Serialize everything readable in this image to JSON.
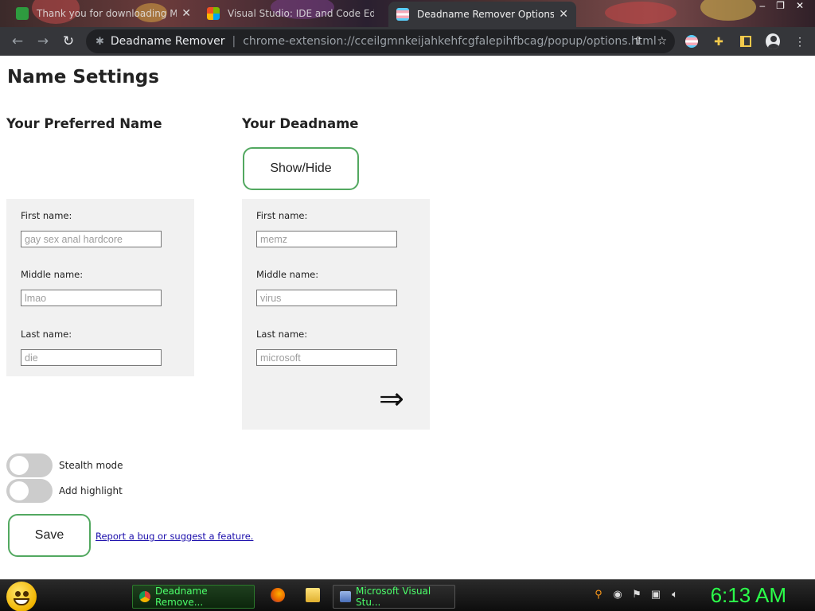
{
  "browser": {
    "tabs": [
      {
        "title": "Thank you for downloading Mi...",
        "favicon_color": "#2e9b3f",
        "active": false
      },
      {
        "title": "Visual Studio: IDE and Code Edit...",
        "favicon_color": "#f25022",
        "active": false
      },
      {
        "title": "Deadname Remover Options",
        "favicon_color": "#f5a9b8",
        "active": true
      }
    ],
    "close_glyph": "✕",
    "window_controls": [
      "–",
      "❐",
      "✕"
    ],
    "nav": {
      "back_glyph": "←",
      "forward_glyph": "→",
      "reload_glyph": "↻"
    },
    "omnibox": {
      "icon": "puzzle-icon",
      "site_name": "Deadname Remover",
      "url": "chrome-extension://cceilgmnkeijahkehfcgfalepihfbcag/popup/options.html"
    },
    "toolbar_icons": [
      "share-icon",
      "star-icon",
      "trans-flag-icon",
      "puzzle-icon",
      "side-panel-icon",
      "profile-icon",
      "menu-icon"
    ]
  },
  "page": {
    "title": "Name Settings",
    "preferred": {
      "heading": "Your Preferred Name",
      "fields": [
        {
          "label": "First name:",
          "placeholder": "gay sex anal hardcore"
        },
        {
          "label": "Middle name:",
          "placeholder": "lmao"
        },
        {
          "label": "Last name:",
          "placeholder": "die"
        }
      ]
    },
    "deadname": {
      "heading": "Your Deadname",
      "show_hide_label": "Show/Hide",
      "fields": [
        {
          "label": "First name:",
          "placeholder": "memz"
        },
        {
          "label": "Middle name:",
          "placeholder": "virus"
        },
        {
          "label": "Last name:",
          "placeholder": "microsoft"
        }
      ],
      "arrow_glyph": "⇒"
    },
    "toggles": [
      {
        "label": "Stealth mode",
        "on": false
      },
      {
        "label": "Add highlight",
        "on": false
      }
    ],
    "save_label": "Save",
    "report_link": "Report a bug or suggest a feature."
  },
  "taskbar": {
    "tasks": [
      {
        "label": "Deadname Remove...",
        "active": true
      },
      {
        "label": "Microsoft Visual Stu...",
        "active": false
      }
    ],
    "quick_launch": [
      "firefox-icon",
      "folder-icon"
    ],
    "tray_icons": [
      "search-icon",
      "status-icon",
      "network-icon",
      "display-icon",
      "volume-icon"
    ],
    "clock": "6:13 AM"
  },
  "colors": {
    "accent_green": "#52a860",
    "panel_bg": "#f1f1f1",
    "chrome_dark": "#35363a",
    "clock_green": "#2bff4a"
  }
}
